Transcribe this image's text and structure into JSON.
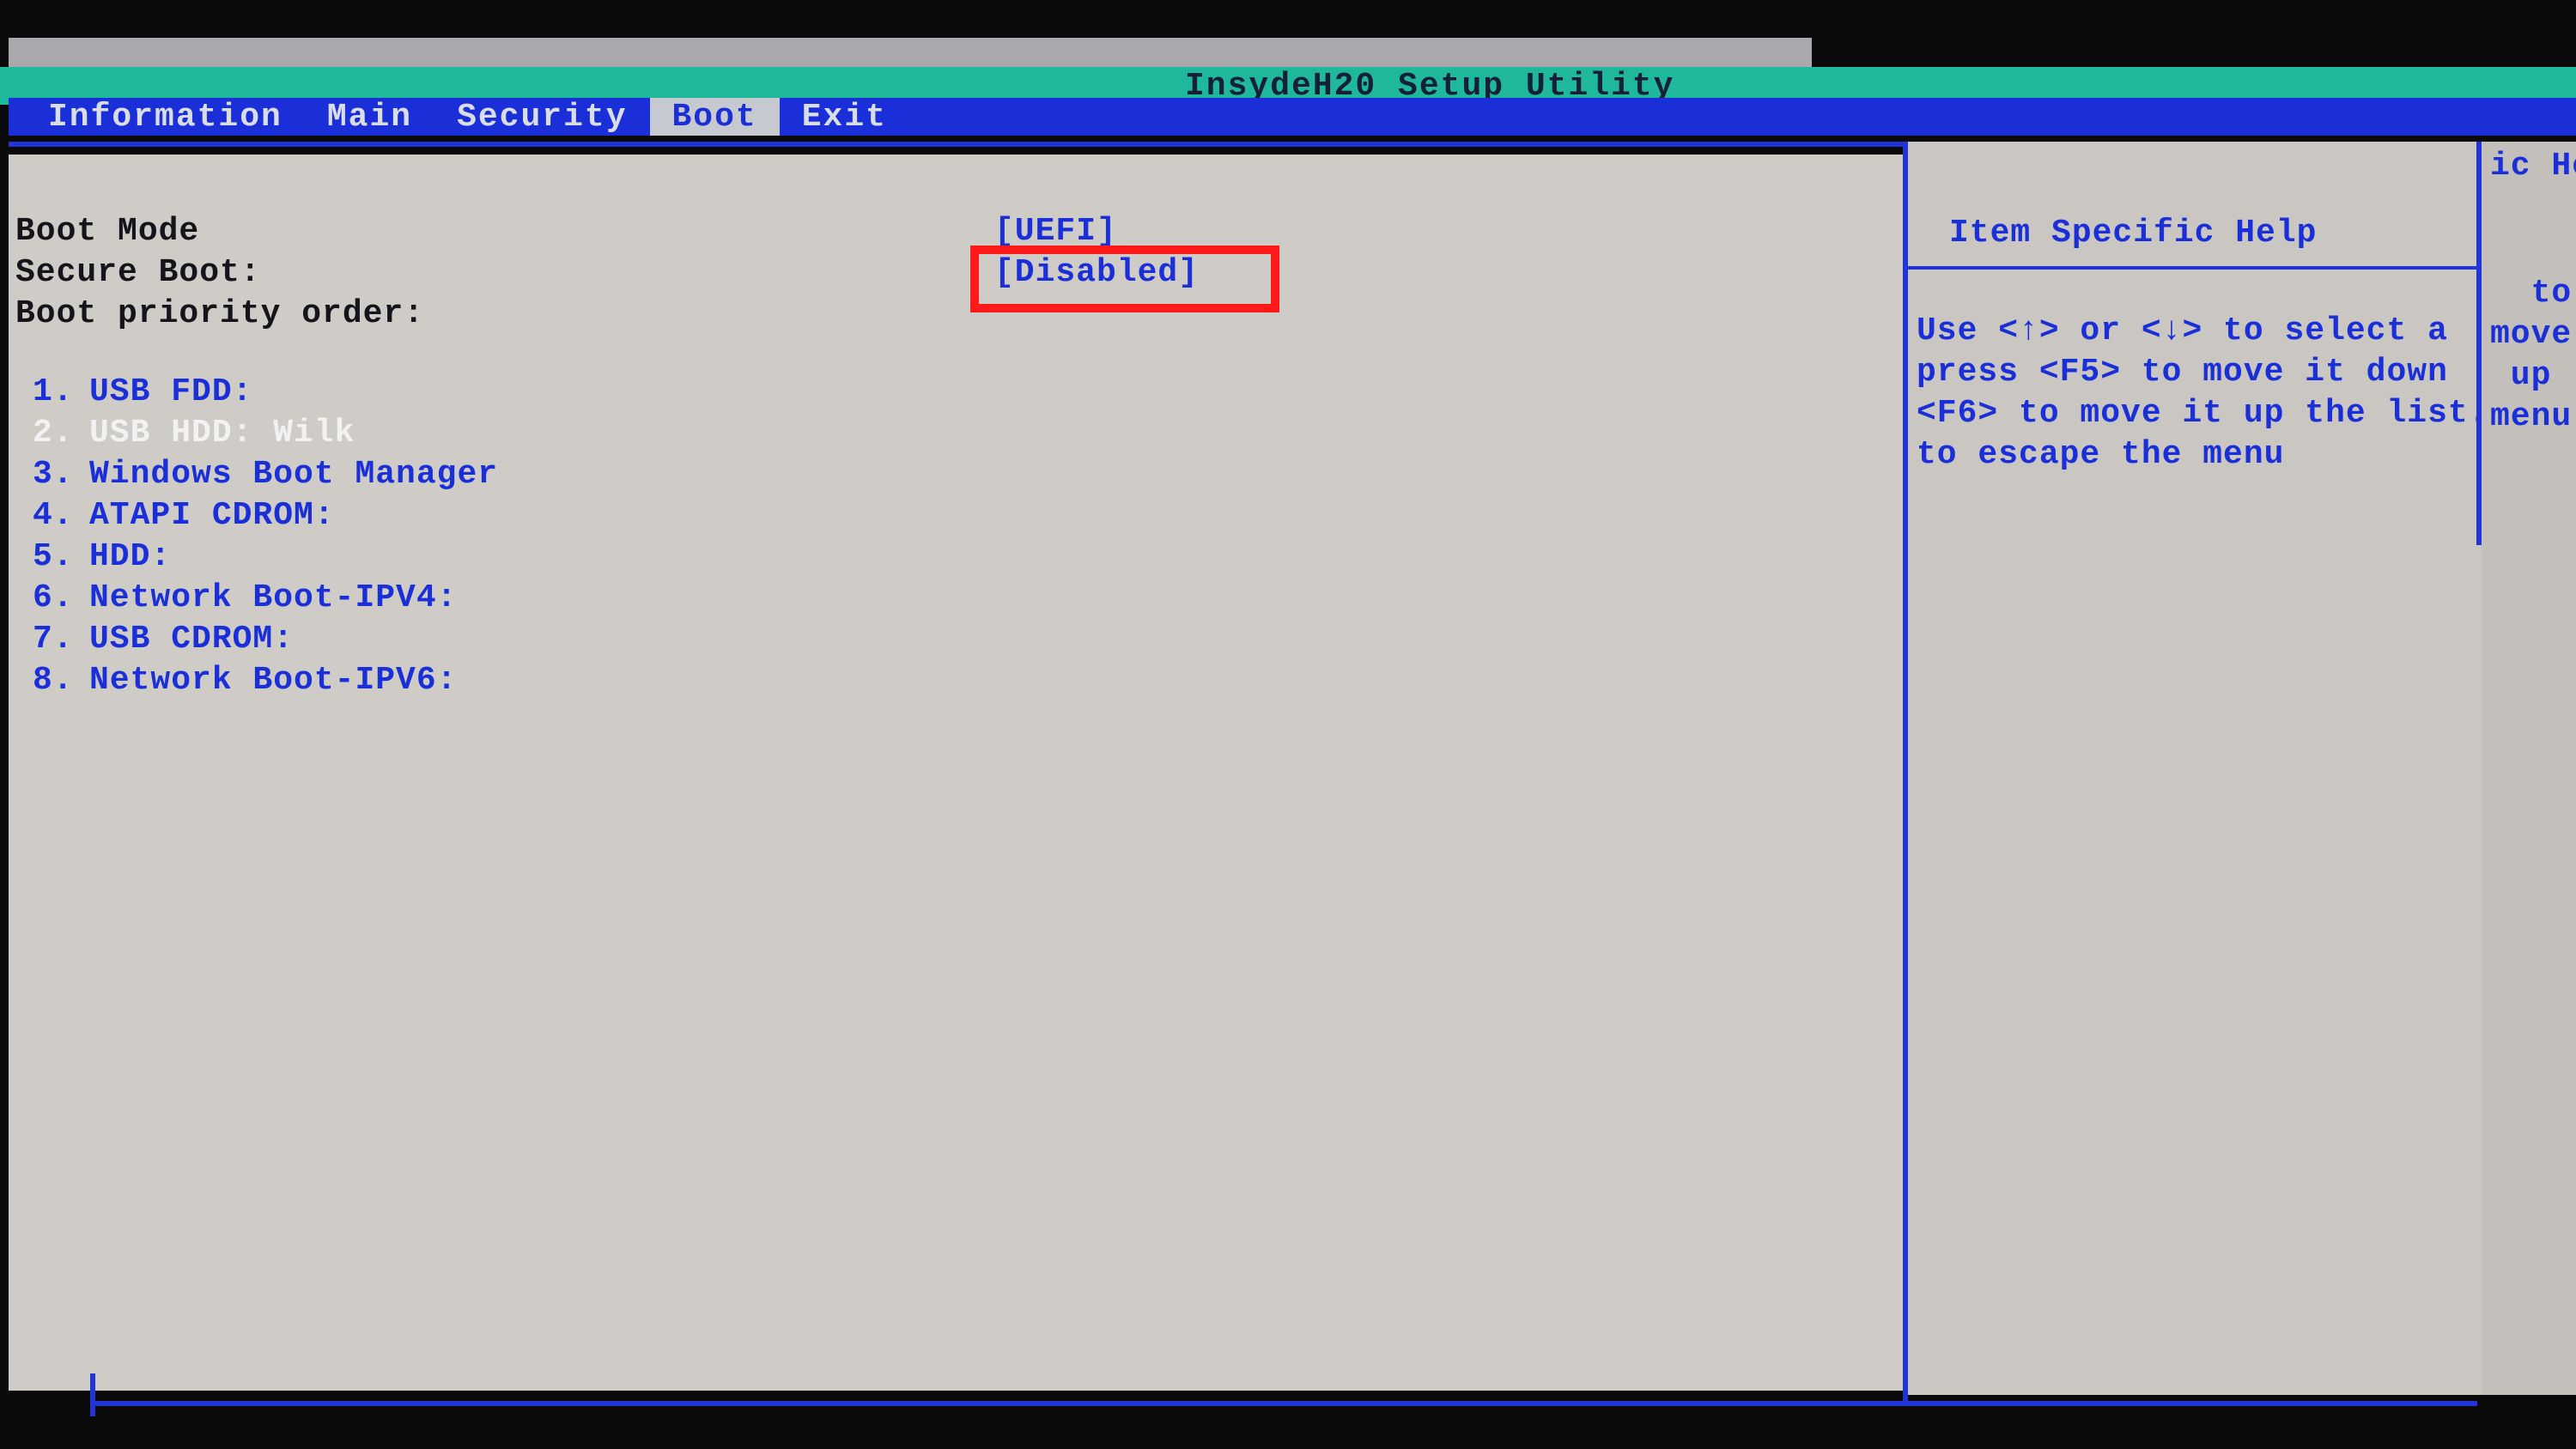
{
  "title": "InsydeH20 Setup Utility",
  "menu": {
    "items": [
      "Information",
      "Main",
      "Security",
      "Boot",
      "Exit"
    ],
    "active_index": 3
  },
  "settings": {
    "boot_mode": {
      "label": "Boot Mode",
      "value": "[UEFI]"
    },
    "secure_boot": {
      "label": "Secure Boot:",
      "value": "[Disabled]"
    },
    "priority_label": "Boot priority order:"
  },
  "boot_order": [
    {
      "n": "1.",
      "text": "USB FDD:",
      "sel": false
    },
    {
      "n": "2.",
      "text": "USB HDD: Wilk",
      "sel": true
    },
    {
      "n": "3.",
      "text": "Windows Boot Manager",
      "sel": false
    },
    {
      "n": "4.",
      "text": "ATAPI CDROM:",
      "sel": false
    },
    {
      "n": "5.",
      "text": "HDD:",
      "sel": false
    },
    {
      "n": "6.",
      "text": "Network Boot-IPV4:",
      "sel": false
    },
    {
      "n": "7.",
      "text": "USB CDROM:",
      "sel": false
    },
    {
      "n": "8.",
      "text": "Network Boot-IPV6:",
      "sel": false
    }
  ],
  "help": {
    "title": "Item Specific Help",
    "body": "Use <↑> or <↓> to select a\npress <F5> to move it down\n<F6> to move it up the list.\nto escape the menu"
  },
  "ghost": {
    "g1": "ic He",
    "g2": "  to s",
    "g3": "move",
    "g4": " up",
    "g5": "menu",
    "g6": ""
  }
}
